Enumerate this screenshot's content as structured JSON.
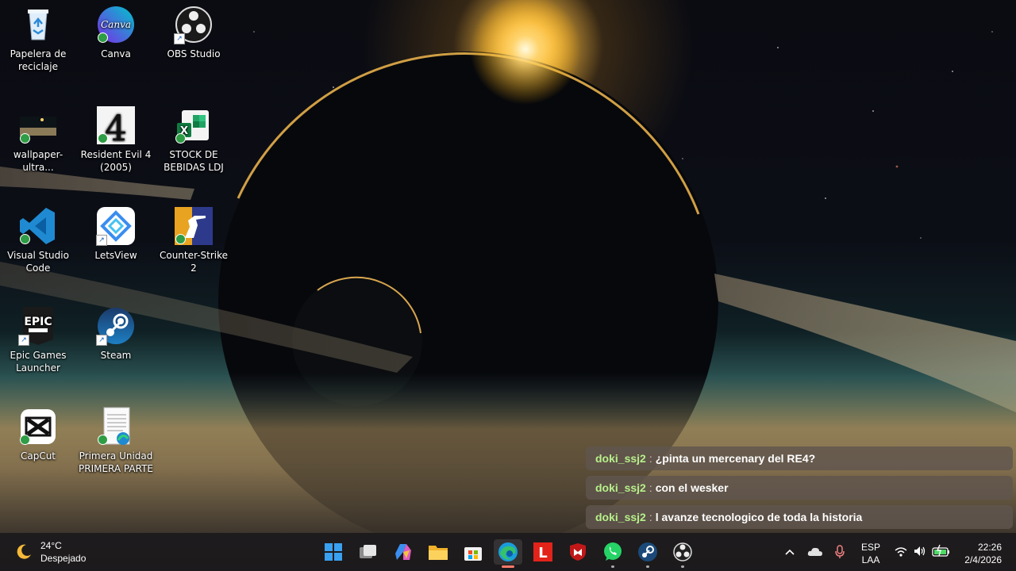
{
  "desktop": {
    "icons": [
      {
        "label": "Papelera de reciclaje",
        "icon": "recycle-bin-icon"
      },
      {
        "label": "Canva",
        "icon": "canva-icon",
        "glyph": "Canva"
      },
      {
        "label": "OBS Studio",
        "icon": "obs-icon"
      },
      {
        "label": "wallpaper-ultra...",
        "icon": "image-file-icon"
      },
      {
        "label": "Resident Evil 4 (2005)",
        "icon": "resident-evil-4-icon",
        "glyph": "4"
      },
      {
        "label": "STOCK DE BEBIDAS LDJ",
        "icon": "excel-file-icon",
        "glyph": "X"
      },
      {
        "label": "Visual Studio Code",
        "icon": "vscode-icon"
      },
      {
        "label": "LetsView",
        "icon": "letsview-icon"
      },
      {
        "label": "Counter-Strike 2",
        "icon": "counter-strike-icon"
      },
      {
        "label": "Epic Games Launcher",
        "icon": "epic-games-icon",
        "glyph": "EPIC"
      },
      {
        "label": "Steam",
        "icon": "steam-icon"
      },
      {
        "label": "CapCut",
        "icon": "capcut-icon"
      },
      {
        "label": "Primera Unidad PRIMERA PARTE",
        "icon": "pdf-document-icon"
      }
    ]
  },
  "chat": {
    "messages": [
      {
        "user": "doki_ssj2",
        "sep": ":",
        "text": "¿pinta un mercenary del RE4?"
      },
      {
        "user": "doki_ssj2",
        "sep": ":",
        "text": "con el wesker"
      },
      {
        "user": "doki_ssj2",
        "sep": ":",
        "text": "l avanze tecnologico de toda la historia"
      }
    ]
  },
  "taskbar": {
    "weather": {
      "temp": "24°C",
      "condition": "Despejado",
      "icon": "moon-icon"
    },
    "apps": [
      {
        "name": "start-button",
        "icon": "windows-logo-icon"
      },
      {
        "name": "task-view-button",
        "icon": "task-view-icon"
      },
      {
        "name": "copilot-button",
        "icon": "copilot-icon"
      },
      {
        "name": "file-explorer-button",
        "icon": "folder-icon"
      },
      {
        "name": "microsoft-store-button",
        "icon": "store-icon"
      },
      {
        "name": "edge-button",
        "icon": "edge-icon"
      },
      {
        "name": "lenovo-vantage-button",
        "icon": "lenovo-l-icon",
        "glyph": "L"
      },
      {
        "name": "mcafee-button",
        "icon": "mcafee-shield-icon"
      },
      {
        "name": "whatsapp-button",
        "icon": "whatsapp-icon"
      },
      {
        "name": "steam-taskbar-button",
        "icon": "steam-icon"
      },
      {
        "name": "obs-taskbar-button",
        "icon": "obs-icon"
      }
    ],
    "tray": {
      "language": "ESP",
      "layout": "LAA",
      "time": "22:26",
      "date": "2/4/2026"
    }
  },
  "colors": {
    "chat_user": "#b6f08a",
    "taskbar_bg": "#1c1a1c",
    "edge_indicator": "#ff7a6a"
  }
}
